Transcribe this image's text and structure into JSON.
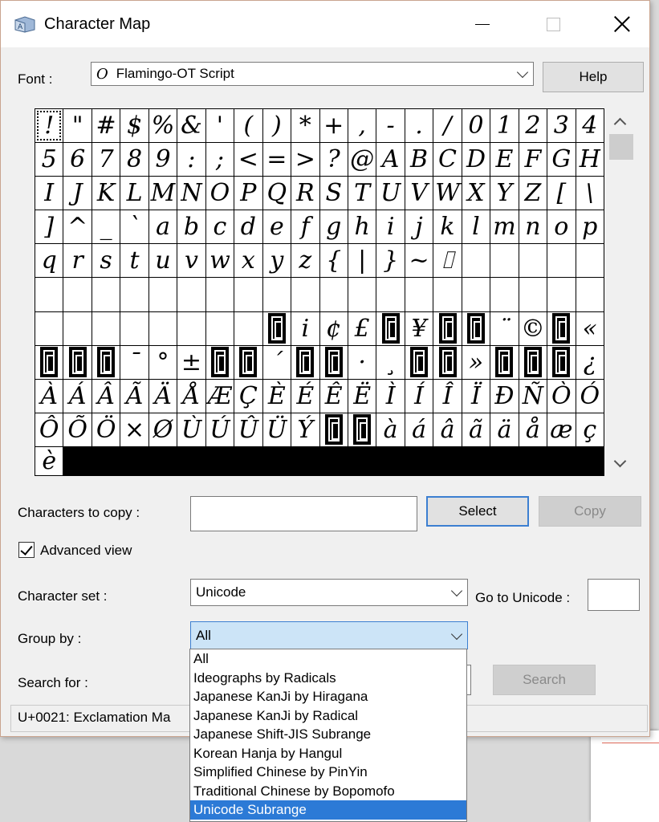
{
  "window": {
    "title": "Character Map"
  },
  "font": {
    "label": "Font :",
    "value": "Flamingo-OT Script",
    "icon": "opentype-font-icon"
  },
  "help_label": "Help",
  "grid": {
    "cells": [
      "!",
      "\"",
      "#",
      "$",
      "%",
      "&",
      "'",
      "(",
      ")",
      "*",
      "+",
      ",",
      "-",
      ".",
      "/",
      "0",
      "1",
      "2",
      "3",
      "4",
      "5",
      "6",
      "7",
      "8",
      "9",
      ":",
      ";",
      "<",
      "=",
      ">",
      "?",
      "@",
      "A",
      "B",
      "C",
      "D",
      "E",
      "F",
      "G",
      "H",
      "I",
      "J",
      "K",
      "L",
      "M",
      "N",
      "O",
      "P",
      "Q",
      "R",
      "S",
      "T",
      "U",
      "V",
      "W",
      "X",
      "Y",
      "Z",
      "[",
      "\\",
      "]",
      "^",
      "_",
      "`",
      "a",
      "b",
      "c",
      "d",
      "e",
      "f",
      "g",
      "h",
      "i",
      "j",
      "k",
      "l",
      "m",
      "n",
      "o",
      "p",
      "q",
      "r",
      "s",
      "t",
      "u",
      "v",
      "w",
      "x",
      "y",
      "z",
      "{",
      "|",
      "}",
      "~",
      "⌷",
      "",
      "",
      "",
      "",
      "",
      "",
      "",
      "",
      "",
      "",
      "",
      "",
      "",
      "",
      "",
      "",
      "",
      "",
      "",
      "",
      "",
      "",
      "",
      "",
      "",
      "",
      "",
      "",
      "",
      "",
      "",
      "",
      "",
      "▯",
      "i",
      "¢",
      "£",
      "▯",
      "¥",
      "▯",
      "▯",
      "¨",
      "©",
      "▯",
      "«",
      "▯",
      "▯",
      "▯",
      "¯",
      "°",
      "±",
      "▯",
      "▯",
      "´",
      "▯",
      "▯",
      "·",
      "¸",
      "▯",
      "▯",
      "»",
      "▯",
      "▯",
      "▯",
      "¿",
      "À",
      "Á",
      "Â",
      "Ã",
      "Ä",
      "Å",
      "Æ",
      "Ç",
      "È",
      "É",
      "Ê",
      "Ë",
      "Ì",
      "Í",
      "Î",
      "Ï",
      "Ð",
      "Ñ",
      "Ò",
      "Ó",
      "Ô",
      "Õ",
      "Ö",
      "×",
      "Ø",
      "Ù",
      "Ú",
      "Û",
      "Ü",
      "Ý",
      "▯",
      "▯",
      "à",
      "á",
      "â",
      "ã",
      "ä",
      "å",
      "æ",
      "ç",
      "è"
    ]
  },
  "copy": {
    "label": "Characters to copy :",
    "value": "",
    "select_label": "Select",
    "copy_label": "Copy"
  },
  "advanced": {
    "label": "Advanced view",
    "checked": true
  },
  "charset": {
    "label": "Character set :",
    "value": "Unicode"
  },
  "goto": {
    "label": "Go to Unicode :",
    "value": ""
  },
  "group": {
    "label": "Group by :",
    "value": "All",
    "options": [
      "All",
      "Ideographs by Radicals",
      "Japanese KanJi by Hiragana",
      "Japanese KanJi by Radical",
      "Japanese Shift-JIS Subrange",
      "Korean Hanja by Hangul",
      "Simplified Chinese by PinYin",
      "Traditional Chinese by Bopomofo",
      "Unicode Subrange"
    ],
    "highlighted": "Unicode Subrange"
  },
  "search": {
    "label": "Search for :",
    "button_label": "Search"
  },
  "status": {
    "text": "U+0021: Exclamation Ma"
  }
}
